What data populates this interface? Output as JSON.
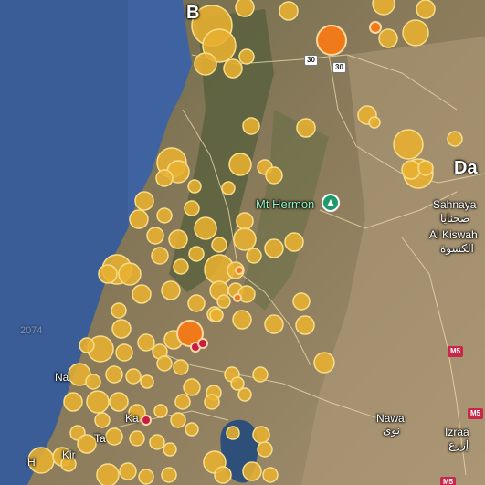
{
  "labels": {
    "beirut": "B",
    "damascus": "Da",
    "sahnaya_en": "Sahnaya",
    "sahnaya_ar": "صحنايا",
    "alkiswah_en": "Al Kiswah",
    "alkiswah_ar": "الكسوة",
    "nawa_en": "Nawa",
    "nawa_ar": "نوى",
    "izraa_en": "Izraa",
    "izraa_ar": "إزرع",
    "mt_hermon": "Mt Hermon",
    "nahariya": "Na",
    "karmiel": "Ka",
    "tamra": "Ta",
    "haifa": "H",
    "kiryat": "Kir",
    "coast_code": "2074"
  },
  "road_shields": {
    "r30_a": "30",
    "r30_b": "30",
    "m5_a": "M5",
    "m5_b": "M5",
    "m5_c": "M5"
  },
  "colors": {
    "sea": "#3d5f9c",
    "land": "#8a7a58",
    "marker_yellow": "#e8b030",
    "marker_orange": "#f07a1a",
    "marker_red": "#c81a48",
    "poi_green": "#1e9a6a"
  }
}
